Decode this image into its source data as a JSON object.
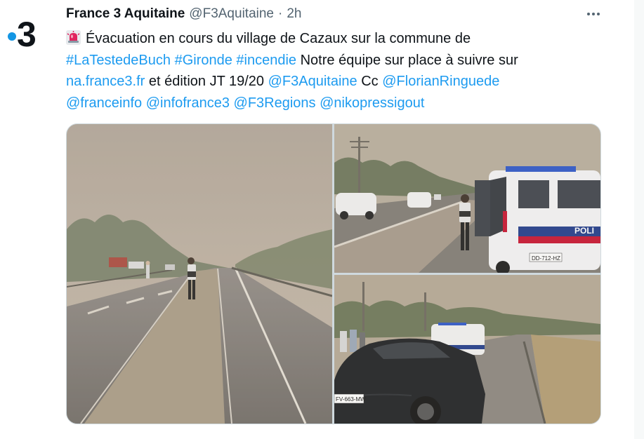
{
  "tweet": {
    "author_name": "France 3 Aquitaine",
    "author_handle": "@F3Aquitaine",
    "separator": "·",
    "time": "2h",
    "avatar_logo_text": "3",
    "avatar_icon": "france3-logo",
    "more_icon": "more-options-icon",
    "alarm_icon": "police-light-emoji",
    "text": {
      "line1": "Évacuation en cours du village de Cazaux sur la commune de",
      "hashtag1": "#LaTestedeBuch",
      "hashtag2": "#Gironde",
      "hashtag3": "#incendie",
      "line2_tail": "Notre équipe sur place à suivre sur",
      "link_url": "na.france3.fr",
      "line3_mid": "et édition JT 19/20",
      "mention1": "@F3Aquitaine",
      "line3_cc": "Cc",
      "mention2": "@FlorianRinguede",
      "mention3": "@franceinfo",
      "mention4": "@infofrance3",
      "mention5": "@F3Regions",
      "mention6": "@nikopressigout"
    }
  },
  "media": {
    "photos": [
      {
        "name": "photo-road-officer",
        "description": "Officer standing on highway median in smoky haze"
      },
      {
        "name": "photo-police-van",
        "description": "Police van with officer on roadside",
        "plate": "DD-712-HZ",
        "van_label": "POLI"
      },
      {
        "name": "photo-black-car",
        "description": "Black car parked near police van on roadside",
        "plate": "FV-663-MW"
      }
    ]
  },
  "colors": {
    "link": "#1d9bf0",
    "text": "#0f1419",
    "secondary": "#536471",
    "france3_blue": "#1496e4"
  }
}
